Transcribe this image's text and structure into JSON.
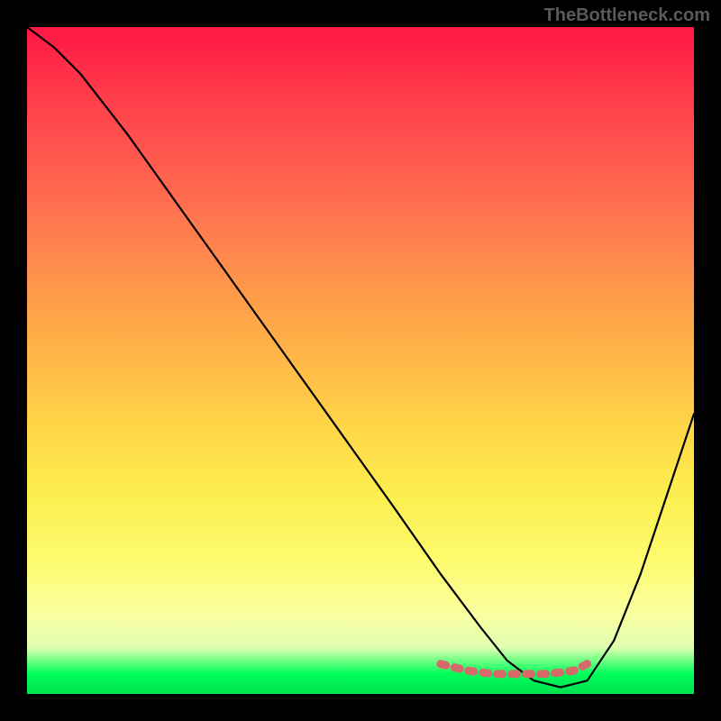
{
  "watermark": "TheBottleneck.com",
  "chart_data": {
    "type": "line",
    "title": "",
    "xlabel": "",
    "ylabel": "",
    "xlim": [
      0,
      100
    ],
    "ylim": [
      0,
      100
    ],
    "series": [
      {
        "name": "curve",
        "x": [
          0,
          4,
          8,
          15,
          25,
          35,
          45,
          55,
          62,
          68,
          72,
          76,
          80,
          84,
          88,
          92,
          96,
          100
        ],
        "y": [
          100,
          97,
          93,
          84,
          70,
          56,
          42,
          28,
          18,
          10,
          5,
          2,
          1,
          2,
          8,
          18,
          30,
          42
        ]
      },
      {
        "name": "hump-marker",
        "x": [
          62,
          66,
          70,
          74,
          78,
          82,
          84
        ],
        "y": [
          4.5,
          3.5,
          3,
          3,
          3,
          3.5,
          4.5
        ]
      }
    ],
    "background_gradient": {
      "top": "#ff1744",
      "mid": "#ffd647",
      "bottom": "#00e050"
    },
    "minimum_region_color": "#d66a6a"
  }
}
